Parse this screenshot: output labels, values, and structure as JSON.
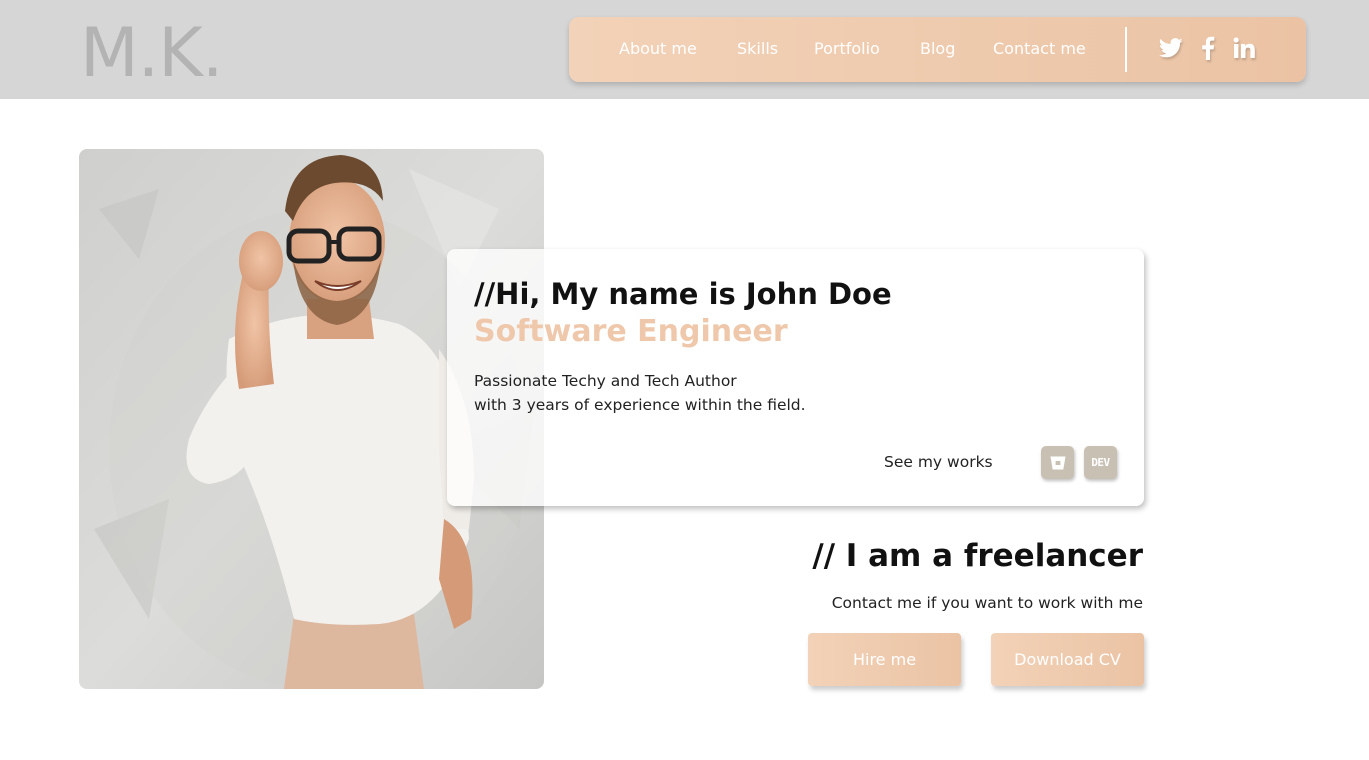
{
  "header": {
    "logo": "M.K.",
    "nav": [
      "About me",
      "Skills",
      "Portfolio",
      "Blog",
      "Contact me"
    ],
    "social_icons": [
      "twitter-icon",
      "facebook-icon",
      "linkedin-icon"
    ]
  },
  "intro_card": {
    "title": "//Hi, My name is John Doe",
    "role": "Software Engineer",
    "description_line1": "Passionate Techy and Tech Author",
    "description_line2": "with 3 years of experience within the field.",
    "works_label": "See my works",
    "work_icons": [
      "bitbucket-icon",
      "dev-icon"
    ],
    "dev_badge_text": "DEV"
  },
  "freelance": {
    "title": "// I am a freelancer",
    "subtitle": "Contact me if you want to work with me",
    "hire_button": "Hire me",
    "cv_button": "Download CV"
  },
  "colors": {
    "accent": "#efc8ab",
    "header_bg": "#d6d6d6",
    "logo": "#b3b3b3",
    "badge": "#c9c0b4"
  }
}
